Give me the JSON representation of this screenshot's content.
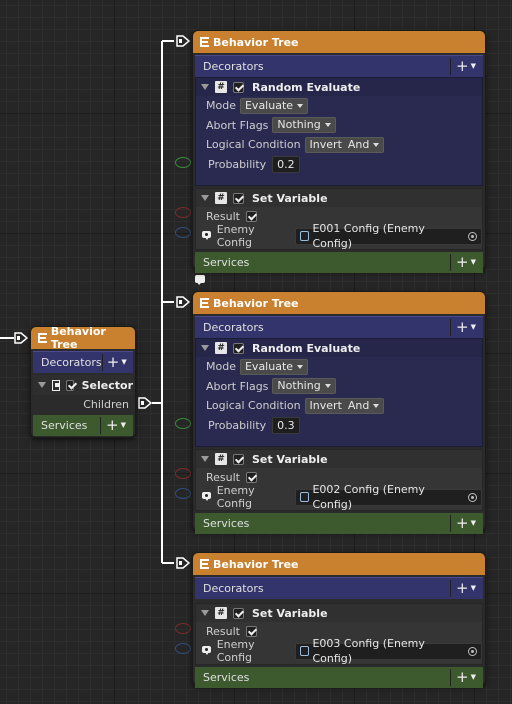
{
  "colors": {
    "header": "#c9812f",
    "decorators_bar": "#34346c",
    "services_bar": "#3d5a2f",
    "decorator_section": "#2a2a50",
    "set_variable_section": "#353535",
    "wire": "#ffffff",
    "port_green": "#3a8a3a",
    "port_red": "#7a2b2b",
    "port_blue": "#2d4f7a"
  },
  "left_node": {
    "title": "Behavior Tree",
    "decorators_label": "Decorators",
    "selector_label": "Selector",
    "children_label": "Children",
    "services_label": "Services"
  },
  "nodes": [
    {
      "title": "Behavior Tree",
      "decorators_label": "Decorators",
      "random": {
        "title": "Random Evaluate",
        "mode_label": "Mode",
        "mode_value": "Evaluate",
        "abort_label": "Abort Flags",
        "abort_value": "Nothing",
        "logic_label": "Logical Condition",
        "logic_invert": "Invert",
        "logic_value": "And",
        "prob_label": "Probability",
        "prob_value": "0.2"
      },
      "setvar": {
        "title": "Set Variable",
        "result_label": "Result",
        "config_label": "Enemy Config",
        "config_value": "E001 Config (Enemy Config)"
      },
      "services_label": "Services"
    },
    {
      "title": "Behavior Tree",
      "decorators_label": "Decorators",
      "random": {
        "title": "Random Evaluate",
        "mode_label": "Mode",
        "mode_value": "Evaluate",
        "abort_label": "Abort Flags",
        "abort_value": "Nothing",
        "logic_label": "Logical Condition",
        "logic_invert": "Invert",
        "logic_value": "And",
        "prob_label": "Probability",
        "prob_value": "0.3"
      },
      "setvar": {
        "title": "Set Variable",
        "result_label": "Result",
        "config_label": "Enemy Config",
        "config_value": "E002 Config (Enemy Config)"
      },
      "services_label": "Services"
    },
    {
      "title": "Behavior Tree",
      "decorators_label": "Decorators",
      "setvar": {
        "title": "Set Variable",
        "result_label": "Result",
        "config_label": "Enemy Config",
        "config_value": "E003 Config (Enemy Config)"
      },
      "services_label": "Services"
    }
  ],
  "icons": {
    "tree": "behavior-tree-icon",
    "add": "plus-icon",
    "script": "script-hash-icon",
    "checkbox": "checkbox-checked-icon",
    "selector": "selector-icon",
    "flow_port": "flow-port-icon",
    "pin": "pin-icon",
    "object_picker": "object-picker-icon",
    "comment": "comment-bubble-icon"
  }
}
